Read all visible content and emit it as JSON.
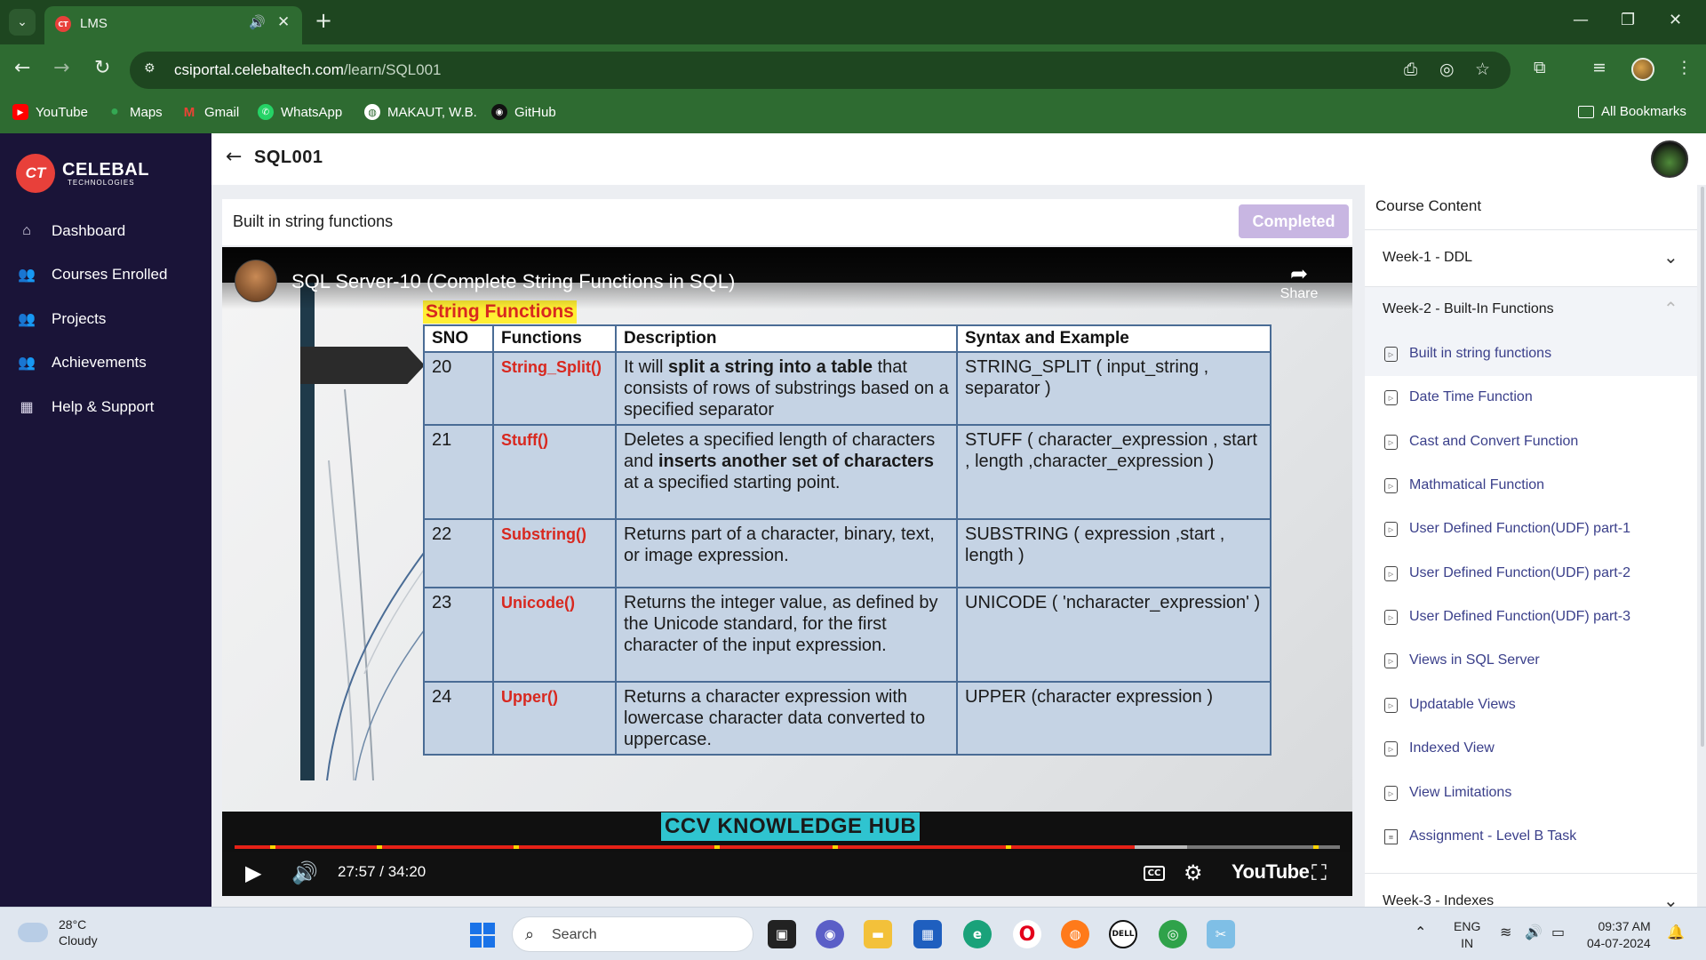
{
  "browser": {
    "tab_title": "LMS",
    "url_host": "csiportal.celebaltech.com",
    "url_path": "/learn/SQL001",
    "bookmarks": [
      {
        "label": "YouTube",
        "icon": "youtube-icon",
        "color": "#ff0000"
      },
      {
        "label": "Maps",
        "icon": "maps-icon",
        "color": "#34a853"
      },
      {
        "label": "Gmail",
        "icon": "gmail-icon",
        "color": "#ea4335"
      },
      {
        "label": "WhatsApp",
        "icon": "whatsapp-icon",
        "color": "#25d366"
      },
      {
        "label": "MAKAUT, W.B.",
        "icon": "globe-icon",
        "color": "#ffffff"
      },
      {
        "label": "GitHub",
        "icon": "github-icon",
        "color": "#111111"
      }
    ],
    "all_bookmarks": "All Bookmarks"
  },
  "brand": {
    "mark": "CT",
    "name": "Celebal",
    "tagline": "Technologies",
    "accent": "#e8403a"
  },
  "sidebar": {
    "items": [
      {
        "label": "Dashboard",
        "icon": "home-icon"
      },
      {
        "label": "Courses Enrolled",
        "icon": "users-icon"
      },
      {
        "label": "Projects",
        "icon": "users-icon"
      },
      {
        "label": "Achievements",
        "icon": "users-icon"
      },
      {
        "label": "Help & Support",
        "icon": "calendar-icon"
      }
    ]
  },
  "header": {
    "course_code": "SQL001"
  },
  "lesson": {
    "title": "Built in string functions",
    "status_button": "Completed"
  },
  "video": {
    "title": "SQL Server-10 (Complete String Functions in SQL)",
    "share_label": "Share",
    "time": "27:57 / 34:20",
    "played_fraction": 0.814,
    "buffered_fraction": 0.862,
    "yt_label": "YouTube",
    "cc_label": "CC",
    "slide": {
      "heading": "String Functions",
      "columns": [
        "SNO",
        "Functions",
        "Description",
        "Syntax and Example"
      ],
      "rows": [
        {
          "sno": "20",
          "fn": "String_Split()",
          "desc_pre": "It will ",
          "desc_bold": "split a string into a table",
          "desc_post": " that consists of rows of substrings based on a specified separator",
          "syntax": "STRING_SPLIT ( input_string , separator )"
        },
        {
          "sno": "21",
          "fn": "Stuff()",
          "desc_pre": "Deletes a specified length of characters and ",
          "desc_bold": "inserts another set of characters",
          "desc_post": " at a specified starting point.",
          "syntax": "STUFF ( character_expression , start , length ,character_expression )"
        },
        {
          "sno": "22",
          "fn": "Substring()",
          "desc_pre": "Returns part of a character, binary, text, or image expression.",
          "desc_bold": "",
          "desc_post": "",
          "syntax": "SUBSTRING ( expression ,start , length )"
        },
        {
          "sno": "23",
          "fn": "Unicode()",
          "desc_pre": "Returns the integer value, as defined by the Unicode standard, for the first character of the input expression.",
          "desc_bold": "",
          "desc_post": "",
          "syntax": "UNICODE ( 'ncharacter_expression' )"
        },
        {
          "sno": "24",
          "fn": "Upper()",
          "desc_pre": "Returns a character expression with lowercase character data converted to uppercase.",
          "desc_bold": "",
          "desc_post": "",
          "syntax": "UPPER (character expression )"
        }
      ],
      "footer": "CCV KNOWLEDGE HUB"
    }
  },
  "course_content": {
    "title": "Course Content",
    "weeks": [
      {
        "label": "Week-1 - DDL",
        "expanded": false
      },
      {
        "label": "Week-2 - Built-In Functions",
        "expanded": true
      },
      {
        "label": "Week-3 - Indexes",
        "expanded": false
      }
    ],
    "lessons": [
      {
        "label": "Built in string functions",
        "icon": "video-icon",
        "active": true
      },
      {
        "label": "Date Time Function",
        "icon": "video-icon"
      },
      {
        "label": "Cast and Convert Function",
        "icon": "video-icon"
      },
      {
        "label": "Mathmatical Function",
        "icon": "video-icon"
      },
      {
        "label": "User Defined Function(UDF) part-1",
        "icon": "video-icon"
      },
      {
        "label": "User Defined Function(UDF) part-2",
        "icon": "video-icon"
      },
      {
        "label": "User Defined Function(UDF) part-3",
        "icon": "video-icon"
      },
      {
        "label": "Views in SQL Server",
        "icon": "video-icon"
      },
      {
        "label": "Updatable Views",
        "icon": "video-icon"
      },
      {
        "label": "Indexed View",
        "icon": "video-icon"
      },
      {
        "label": "View Limitations",
        "icon": "video-icon"
      },
      {
        "label": "Assignment - Level B Task",
        "icon": "document-icon"
      }
    ]
  },
  "taskbar": {
    "weather_temp": "28°C",
    "weather_desc": "Cloudy",
    "search_placeholder": "Search",
    "lang_line1": "ENG",
    "lang_line2": "IN",
    "time": "09:37 AM",
    "date": "04-07-2024"
  }
}
